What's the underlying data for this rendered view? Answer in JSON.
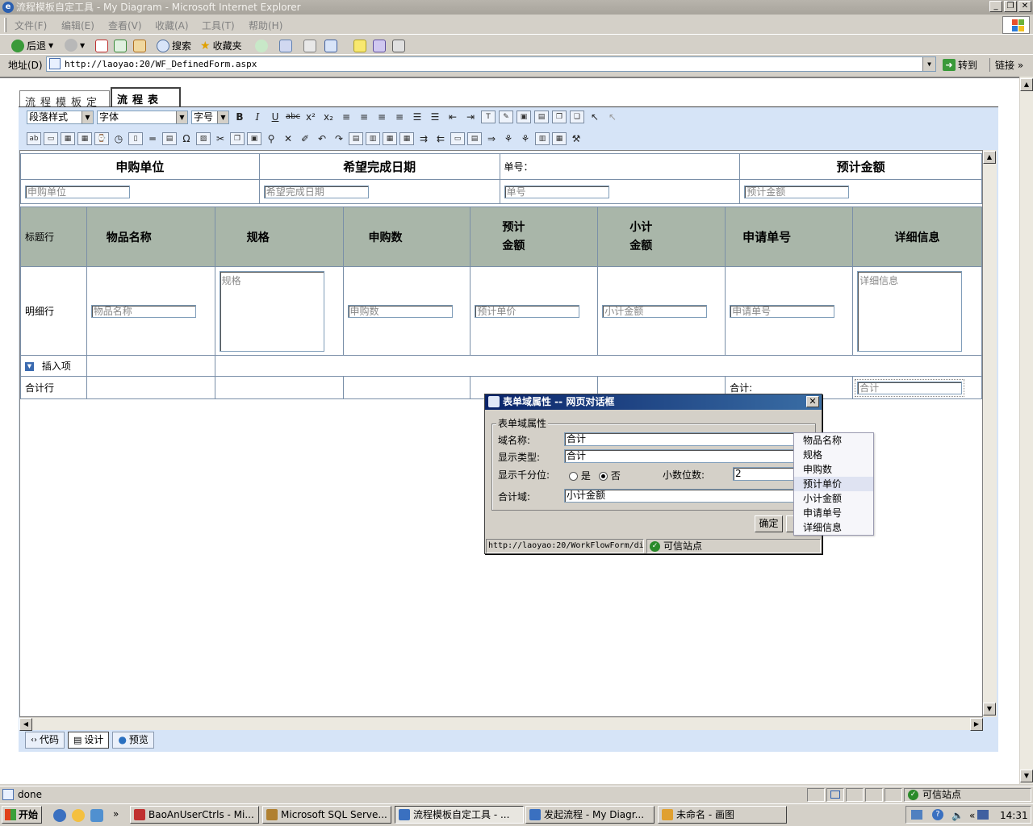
{
  "window": {
    "title": "流程模板自定工具 - My Diagram - Microsoft Internet Explorer",
    "buttons": [
      "_",
      "❐",
      "✕"
    ]
  },
  "menu": [
    "文件(F)",
    "编辑(E)",
    "查看(V)",
    "收藏(A)",
    "工具(T)",
    "帮助(H)"
  ],
  "toolbar": {
    "back": "后退",
    "search": "搜索",
    "favorites": "收藏夹"
  },
  "address": {
    "label": "地址(D)",
    "url": "http://laoyao:20/WF_DefinedForm.aspx",
    "go": "转到",
    "links": "链接"
  },
  "tabs": {
    "inactive": "流程模板定义",
    "active": "流程表单"
  },
  "format": {
    "paragraph": "段落样式",
    "font": "字体",
    "size": "字号"
  },
  "form": {
    "header": [
      "申购单位",
      "希望完成日期",
      "单号：",
      "预计金额"
    ],
    "header_inputs": [
      "申购单位",
      "希望完成日期",
      "单号",
      "预计金额"
    ],
    "grid_title_row": "标题行",
    "grid_columns": [
      "物品名称",
      "规格",
      "申购数",
      "预计",
      "金额",
      "小计",
      "金额",
      "申请单号",
      "详细信息"
    ],
    "detail_row": "明细行",
    "detail_inputs": [
      "物品名称",
      "规格",
      "申购数",
      "预计单价",
      "小计金额",
      "申请单号",
      "详细信息"
    ],
    "insert_item": "插入项",
    "total_row": "合计行",
    "total_label": "合计:",
    "total_input": "合计"
  },
  "modes": [
    "代码",
    "设计",
    "预览"
  ],
  "dialog": {
    "title": "表单域属性 -- 网页对话框",
    "legend": "表单域属性",
    "field_name_label": "域名称:",
    "field_name_value": "合计",
    "display_type_label": "显示类型:",
    "display_type_value": "合计",
    "thousands_label": "显示千分位:",
    "yes": "是",
    "no": "否",
    "decimals_label": "小数位数:",
    "decimals_value": "2",
    "total_field_label": "合计域:",
    "total_field_value": "小计金额",
    "ok": "确定",
    "url": "http://laoyao:20/WorkFlowForm/di",
    "trusted": "可信站点"
  },
  "dropdown": {
    "items": [
      "物品名称",
      "规格",
      "申购数",
      "预计单价",
      "小计金额",
      "申请单号",
      "详细信息"
    ],
    "highlighted": "预计单价"
  },
  "status": {
    "text": "done",
    "zone": "可信站点"
  },
  "taskbar": {
    "start": "开始",
    "tasks": [
      "BaoAnUserCtrls - Mi...",
      "Microsoft SQL Serve...",
      "流程模板自定工具 - ...",
      "发起流程 - My Diagr...",
      "未命名 - 画图"
    ],
    "time": "14:31"
  }
}
